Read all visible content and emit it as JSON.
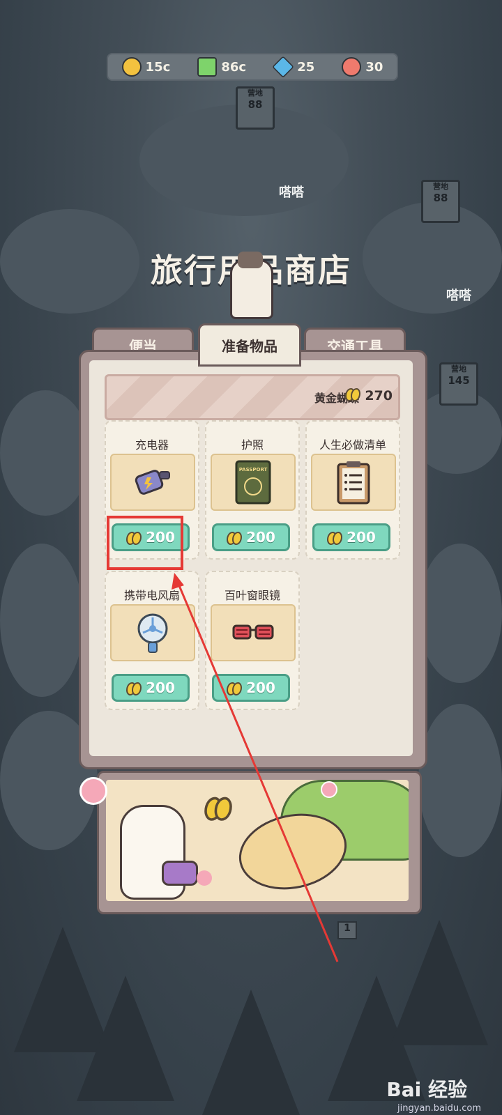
{
  "currency_bar": {
    "items": [
      {
        "icon": "coin-icon",
        "value": "15c",
        "color": "#f3c23f"
      },
      {
        "icon": "lightning-icon",
        "value": "86c",
        "color": "#7ed36b"
      },
      {
        "icon": "gem-icon",
        "value": "25",
        "color": "#5bb7e8"
      },
      {
        "icon": "cookie-icon",
        "value": "30",
        "color": "#ef7a6d"
      }
    ]
  },
  "scenery": {
    "signposts": [
      {
        "label": "营地",
        "number": "88"
      },
      {
        "label": "营地",
        "number": "88"
      },
      {
        "label": "营地",
        "number": "145"
      }
    ],
    "sound_effects": [
      "嗒嗒",
      "嗒嗒"
    ],
    "plaque": "1"
  },
  "shop": {
    "title": "旅行用品商店",
    "tabs": [
      {
        "label": "便当",
        "active": false
      },
      {
        "label": "准备物品",
        "active": true
      },
      {
        "label": "交通工具",
        "active": false
      }
    ],
    "balance_label": "黄金蝴蝶",
    "balance_value": "270",
    "items": [
      {
        "name": "充电器",
        "price": "200",
        "icon": "charger-icon"
      },
      {
        "name": "护照",
        "price": "200",
        "icon": "passport-icon",
        "passport_text": "PASSPORT"
      },
      {
        "name": "人生必做清单",
        "price": "200",
        "icon": "clipboard-icon"
      },
      {
        "name": "携带电风扇",
        "price": "200",
        "icon": "fan-icon"
      },
      {
        "name": "百叶窗眼镜",
        "price": "200",
        "icon": "shutter-glasses-icon"
      }
    ]
  },
  "watermark": {
    "brand": "Bai 经验",
    "url": "jingyan.baidu.com"
  },
  "colors": {
    "highlight": "#e53935",
    "buy_button": "#7fd8be",
    "panel_frame": "#a79493"
  }
}
